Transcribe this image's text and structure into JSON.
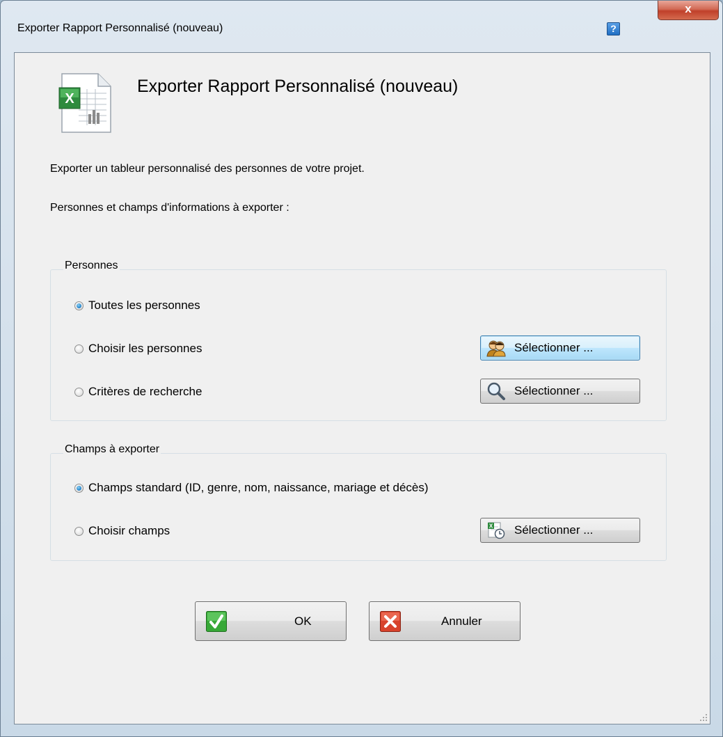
{
  "window": {
    "title": "Exporter Rapport Personnalisé (nouveau)",
    "help_label": "?",
    "close_label": "x"
  },
  "header": {
    "heading": "Exporter Rapport Personnalisé (nouveau)",
    "icon": "excel-spreadsheet-icon"
  },
  "description": {
    "line1": "Exporter un tableur personnalisé des personnes de votre projet.",
    "line2": "Personnes et champs d'informations à exporter :"
  },
  "persons_group": {
    "legend": "Personnes",
    "options": [
      {
        "label": "Toutes les personnes",
        "selected": true
      },
      {
        "label": "Choisir les personnes",
        "selected": false
      },
      {
        "label": "Critères de recherche",
        "selected": false
      }
    ],
    "select_people_button": {
      "label": "Sélectionner ...",
      "icon": "people-icon"
    },
    "select_criteria_button": {
      "label": "Sélectionner ...",
      "icon": "magnifier-icon"
    }
  },
  "fields_group": {
    "legend": "Champs à exporter",
    "options": [
      {
        "label": "Champs standard (ID, genre, nom, naissance, mariage et décès)",
        "selected": true
      },
      {
        "label": "Choisir champs",
        "selected": false
      }
    ],
    "select_fields_button": {
      "label": "Sélectionner ...",
      "icon": "spreadsheet-fields-icon"
    }
  },
  "footer": {
    "ok_label": "OK",
    "cancel_label": "Annuler"
  },
  "colors": {
    "accent_green": "#2f9e2f",
    "cancel_red": "#d8432c",
    "radio_blue": "#2a8ad0"
  }
}
